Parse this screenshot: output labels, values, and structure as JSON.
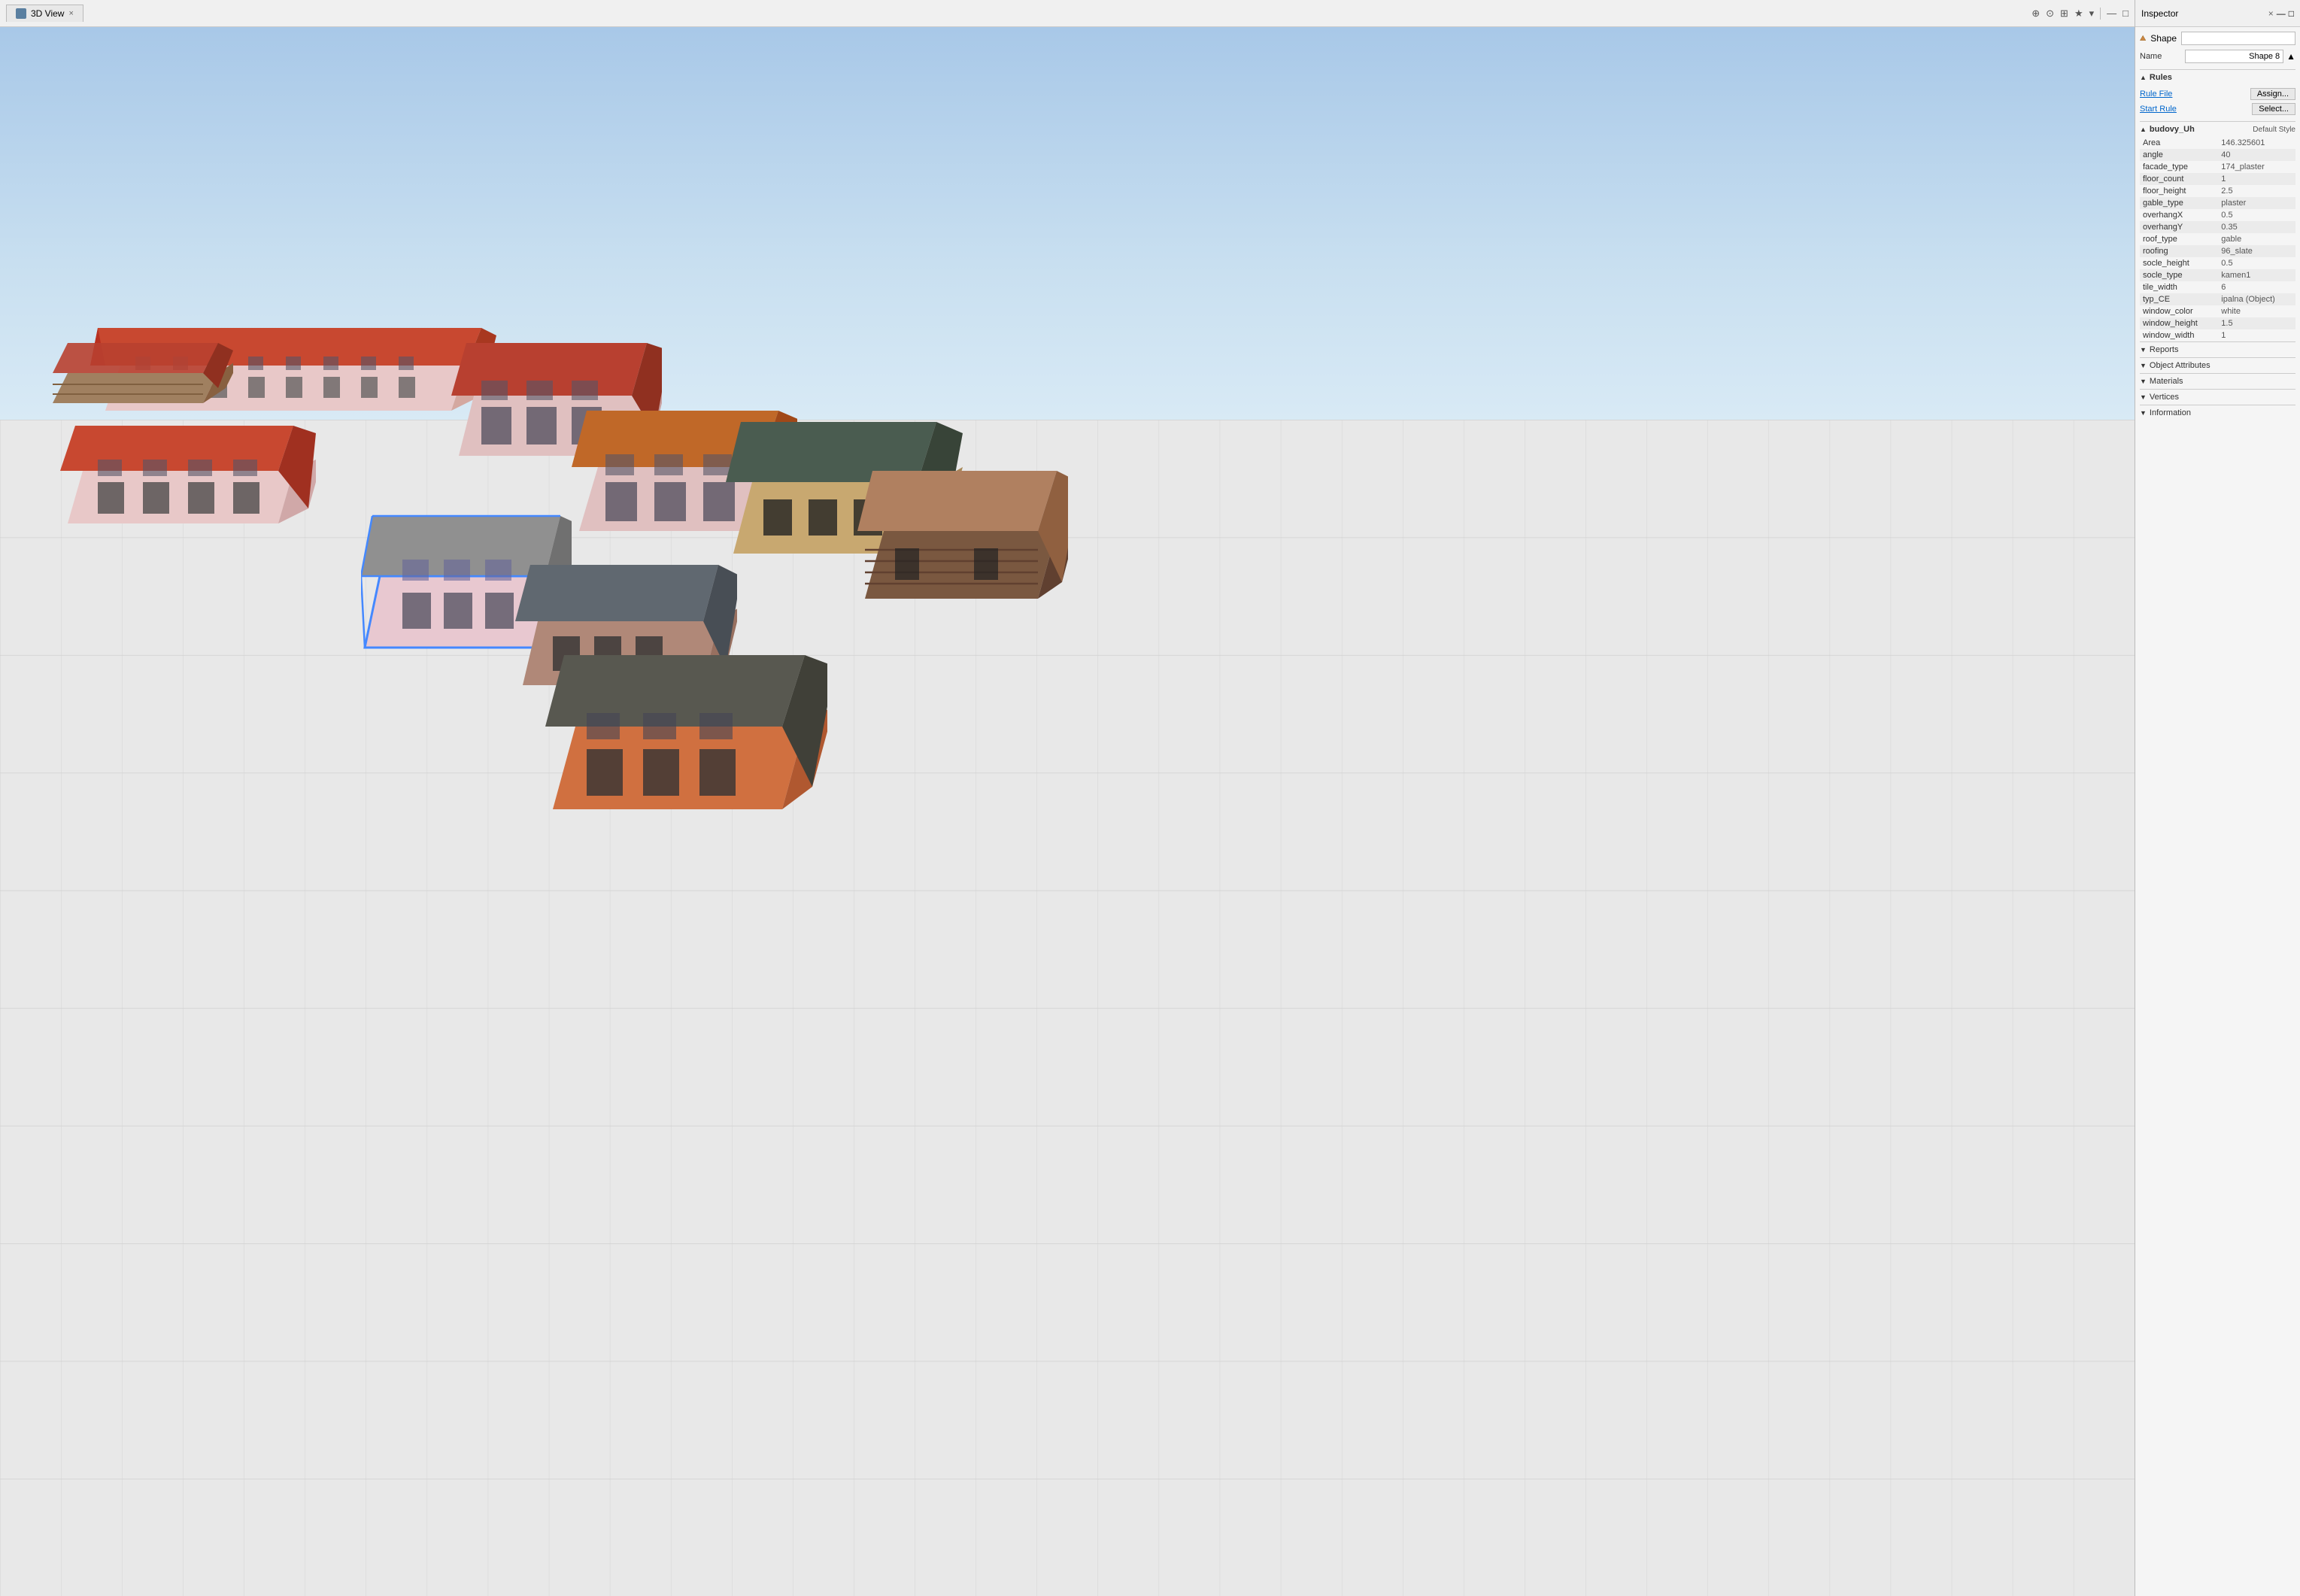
{
  "viewport_tab": {
    "label": "3D View",
    "icon": "cube-icon",
    "close": "×"
  },
  "inspector_tab": {
    "label": "Inspector",
    "close": "×",
    "minimize": "—",
    "maximize": "□"
  },
  "toolbar": {
    "icons": [
      "nav-icon",
      "zoom-icon",
      "camera-icon",
      "star-icon",
      "minimize-icon",
      "maximize-icon"
    ]
  },
  "inspector": {
    "shape_label": "Shape",
    "shape_value": "",
    "name_label": "Name",
    "name_value": "Shape 8",
    "rules_label": "Rules",
    "rule_file_label": "Rule File",
    "rule_file_btn": "Assign...",
    "start_rule_label": "Start Rule",
    "start_rule_btn": "Select...",
    "budovy_label": "budovy_Uh",
    "default_style": "Default Style",
    "attributes": [
      {
        "key": "Area",
        "value": "146.325601"
      },
      {
        "key": "angle",
        "value": "40"
      },
      {
        "key": "facade_type",
        "value": "174_plaster"
      },
      {
        "key": "floor_count",
        "value": "1"
      },
      {
        "key": "floor_height",
        "value": "2.5"
      },
      {
        "key": "gable_type",
        "value": "plaster"
      },
      {
        "key": "overhangX",
        "value": "0.5"
      },
      {
        "key": "overhangY",
        "value": "0.35"
      },
      {
        "key": "roof_type",
        "value": "gable"
      },
      {
        "key": "roofing",
        "value": "96_slate"
      },
      {
        "key": "socle_height",
        "value": "0.5"
      },
      {
        "key": "socle_type",
        "value": "kamen1"
      },
      {
        "key": "tile_width",
        "value": "6"
      },
      {
        "key": "typ_CE",
        "value": "ipalna (Object)"
      },
      {
        "key": "window_color",
        "value": "white"
      },
      {
        "key": "window_height",
        "value": "1.5"
      },
      {
        "key": "window_width",
        "value": "1"
      }
    ],
    "sections": [
      {
        "label": "Reports",
        "expanded": false
      },
      {
        "label": "Object Attributes",
        "expanded": false
      },
      {
        "label": "Materials",
        "expanded": false
      },
      {
        "label": "Vertices",
        "expanded": false
      },
      {
        "label": "Information",
        "expanded": false
      }
    ]
  }
}
